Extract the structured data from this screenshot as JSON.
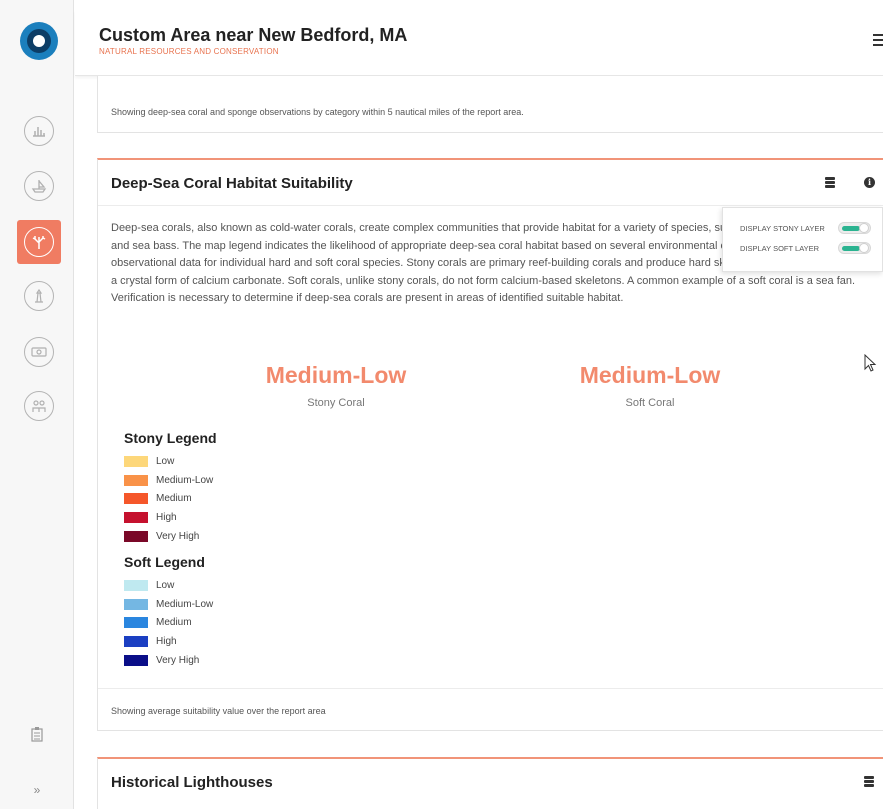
{
  "header": {
    "title": "Custom Area near New Bedford, MA",
    "subtitle": "NATURAL RESOURCES AND CONSERVATION"
  },
  "sidebar": {
    "items": [
      {
        "icon": "chart-icon",
        "active": false
      },
      {
        "icon": "boat-icon",
        "active": false
      },
      {
        "icon": "coral-icon",
        "active": true
      },
      {
        "icon": "lighthouse-icon",
        "active": false
      },
      {
        "icon": "money-icon",
        "active": false
      },
      {
        "icon": "community-icon",
        "active": false
      }
    ],
    "collapse_label": "»"
  },
  "top_card": {
    "footer": "Showing deep-sea coral and sponge observations by category within 5 nautical miles of the report area."
  },
  "coral_card": {
    "title": "Deep-Sea Coral Habitat Suitability",
    "description": "Deep-sea corals, also known as cold-water corals, create complex communities that provide habitat for a variety of species, such as grouper, snapper, and sea bass. The map legend indicates the likelihood of appropriate deep-sea coral habitat based on several environmental characteristics and on observational data for individual hard and soft coral species. Stony corals are primary reef-building corals and produce hard skeletons made of aragonite, a crystal form of calcium carbonate. Soft corals, unlike stony corals, do not form calcium-based skeletons. A common example of a soft coral is a sea fan. Verification is necessary to determine if deep-sea corals are present in areas of identified suitable habitat.",
    "metrics": [
      {
        "value": "Medium-Low",
        "label": "Stony Coral"
      },
      {
        "value": "Medium-Low",
        "label": "Soft Coral"
      }
    ],
    "stony_legend": {
      "title": "Stony Legend",
      "items": [
        {
          "label": "Low",
          "color": "#fdd77a"
        },
        {
          "label": "Medium-Low",
          "color": "#f99248"
        },
        {
          "label": "Medium",
          "color": "#f5572a"
        },
        {
          "label": "High",
          "color": "#c5112e"
        },
        {
          "label": "Very High",
          "color": "#7a0828"
        }
      ]
    },
    "soft_legend": {
      "title": "Soft Legend",
      "items": [
        {
          "label": "Low",
          "color": "#bfe9f0"
        },
        {
          "label": "Medium-Low",
          "color": "#74b7e3"
        },
        {
          "label": "Medium",
          "color": "#2a86df"
        },
        {
          "label": "High",
          "color": "#1b3fc2"
        },
        {
          "label": "Very High",
          "color": "#0a0e88"
        }
      ]
    },
    "footer": "Showing average suitability value over the report area"
  },
  "layer_popup": {
    "stony_label": "DISPLAY STONY LAYER",
    "stony_on": true,
    "soft_label": "DISPLAY SOFT LAYER",
    "soft_on": true
  },
  "next_card": {
    "title": "Historical Lighthouses"
  },
  "colors": {
    "accent": "#f07c62",
    "metric_value": "#f28a6d",
    "toggle_on": "#2bb390"
  }
}
